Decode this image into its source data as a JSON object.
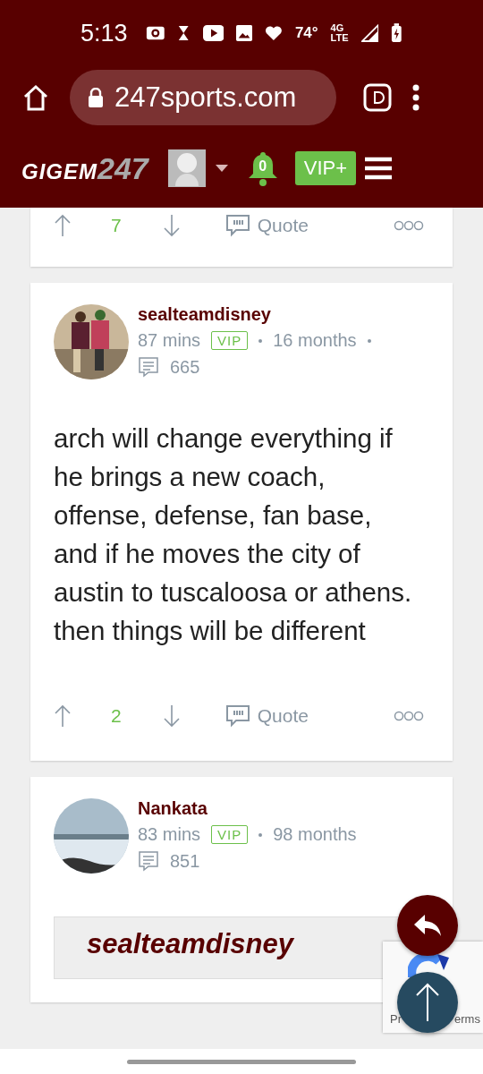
{
  "status_bar": {
    "time": "5:13",
    "temperature": "74°",
    "network_top": "4G",
    "network_bottom": "LTE"
  },
  "browser": {
    "url": "247sports.com"
  },
  "site_nav": {
    "logo_word": "GIGEM",
    "logo_number": "247",
    "notifications": "0",
    "vip_button": "VIP+"
  },
  "posts": [
    {
      "partial": true,
      "upvotes": "7",
      "quote": "Quote"
    },
    {
      "partial": false,
      "author": "sealteamdisney",
      "time": "87 mins",
      "badge": "VIP",
      "tenure": "16 months",
      "trailing_dot": true,
      "comments": "665",
      "body": "arch will change everything if he brings a new coach, offense, defense, fan base, and if he moves the city of austin to tuscaloosa or athens. then things will be different",
      "upvotes": "2",
      "quote": "Quote"
    },
    {
      "partial": false,
      "author": "Nankata",
      "time": "83 mins",
      "badge": "VIP",
      "tenure": "98 months",
      "trailing_dot": false,
      "comments": "851",
      "quoted_author": "sealteamdisney"
    }
  ],
  "recaptcha": {
    "left_text": "Pr",
    "right_text": "erms"
  }
}
